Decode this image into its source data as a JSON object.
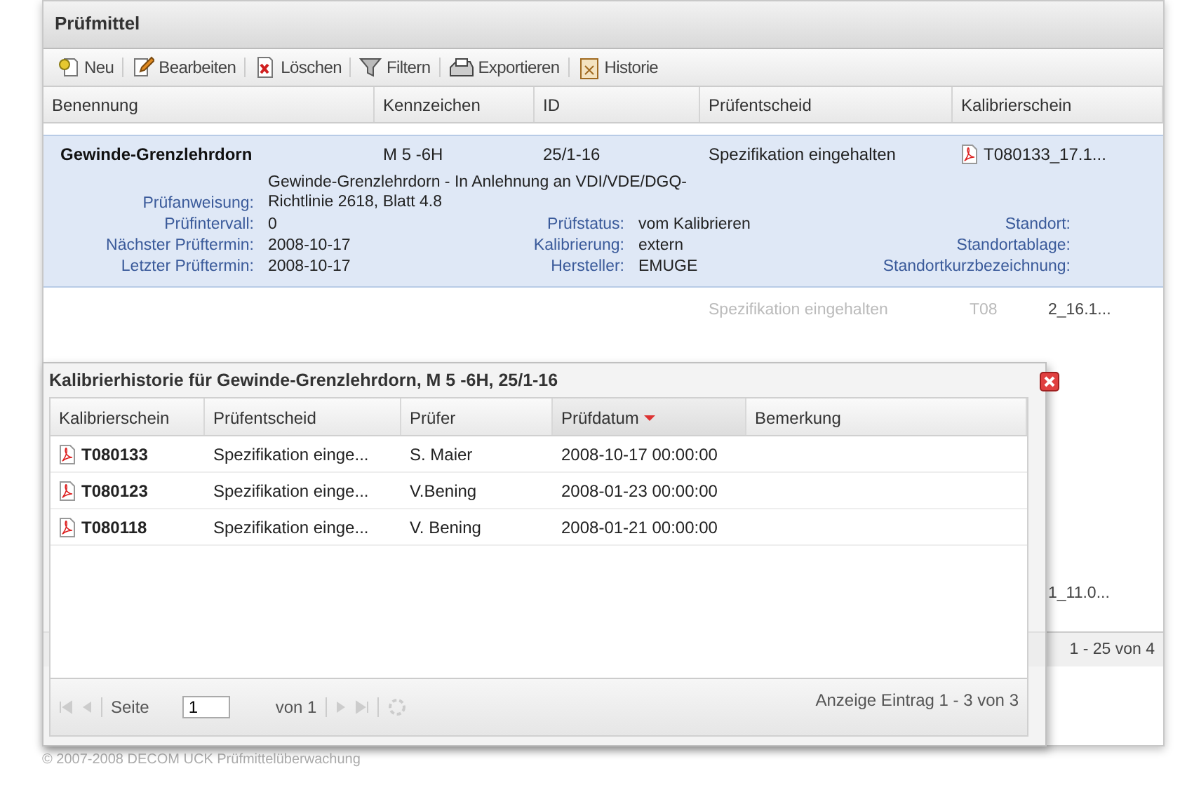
{
  "panel": {
    "title": "Prüfmittel"
  },
  "toolbar": [
    {
      "kind": "new",
      "label": "Neu"
    },
    {
      "kind": "edit",
      "label": "Bearbeiten"
    },
    {
      "kind": "delete",
      "label": "Löschen"
    },
    {
      "kind": "filter",
      "label": "Filtern"
    },
    {
      "kind": "export",
      "label": "Exportieren"
    },
    {
      "kind": "history",
      "label": "Historie"
    }
  ],
  "table": {
    "columns": [
      "Benennung",
      "Kennzeichen",
      "ID",
      "Prüfentscheid",
      "Kalibrierschein"
    ],
    "selected_row": {
      "selected": true,
      "benennung": "Gewinde-Grenzlehrdorn",
      "kennzeichen": "M 5 -6H",
      "id": "25/1-16",
      "pruefentscheid": "Spezifikation eingehalten",
      "kalibrierschein": "T080133_17.1...",
      "details": {
        "pruefanweisung_label": "Prüfanweisung:",
        "pruefanweisung": "Gewinde-Grenzlehrdorn - In Anlehnung an VDI/VDE/DGQ-Richtlinie 2618, Blatt 4.8",
        "fields": [
          {
            "label": "Prüfintervall:",
            "value": "0"
          },
          {
            "label": "Prüfstatus:",
            "value": "vom Kalibrieren"
          },
          {
            "label": "Standort:"
          },
          {
            "label": "Nächster Prüftermin:",
            "value": "2008-10-17"
          },
          {
            "label": "Kalibrierung:",
            "value": "extern"
          },
          {
            "label": "Standortablage:"
          },
          {
            "label": "Letzter Prüftermin:",
            "value": "2008-10-17"
          },
          {
            "label": "Hersteller:",
            "value": "EMUGE"
          },
          {
            "label": "Standortkurzbezeichnung:"
          }
        ]
      }
    },
    "background_rows": [
      {
        "pruefentscheid": "Spezifikation eingehalten",
        "kalibrierschein_start": "T08",
        "kalibrierschein_end": "2_16.1..."
      },
      {
        "kalibrierschein_end": "1_11.0..."
      }
    ],
    "paging_info": "1 - 25 von 4"
  },
  "dialog": {
    "title": "Kalibrierhistorie für Gewinde-Grenzlehrdorn, M 5 -6H, 25/1-16",
    "columns": [
      {
        "label": "Kalibrierschein",
        "sorted": false
      },
      {
        "label": "Prüfentscheid",
        "sorted": false
      },
      {
        "label": "Prüfer",
        "sorted": false
      },
      {
        "label": "Prüfdatum",
        "sorted": true
      },
      {
        "label": "Bemerkung",
        "sorted": false
      }
    ],
    "rows": [
      {
        "kalibrierschein": "T080133",
        "pruefentscheid": "Spezifikation einge...",
        "pruefer": "S. Maier",
        "pruefdatum": "2008-10-17 00:00:00"
      },
      {
        "kalibrierschein": "T080123",
        "pruefentscheid": "Spezifikation einge...",
        "pruefer": "V.Bening",
        "pruefdatum": "2008-01-23 00:00:00"
      },
      {
        "kalibrierschein": "T080118",
        "pruefentscheid": "Spezifikation einge...",
        "pruefer": "V. Bening",
        "pruefdatum": "2008-01-21 00:00:00"
      }
    ],
    "paging": {
      "page_label": "Seite",
      "page": "1",
      "of": "von 1",
      "info": "Anzeige Eintrag 1 - 3 von 3"
    }
  },
  "footer": "© 2007-2008 DECOM UCK Prüfmittelüberwachung"
}
